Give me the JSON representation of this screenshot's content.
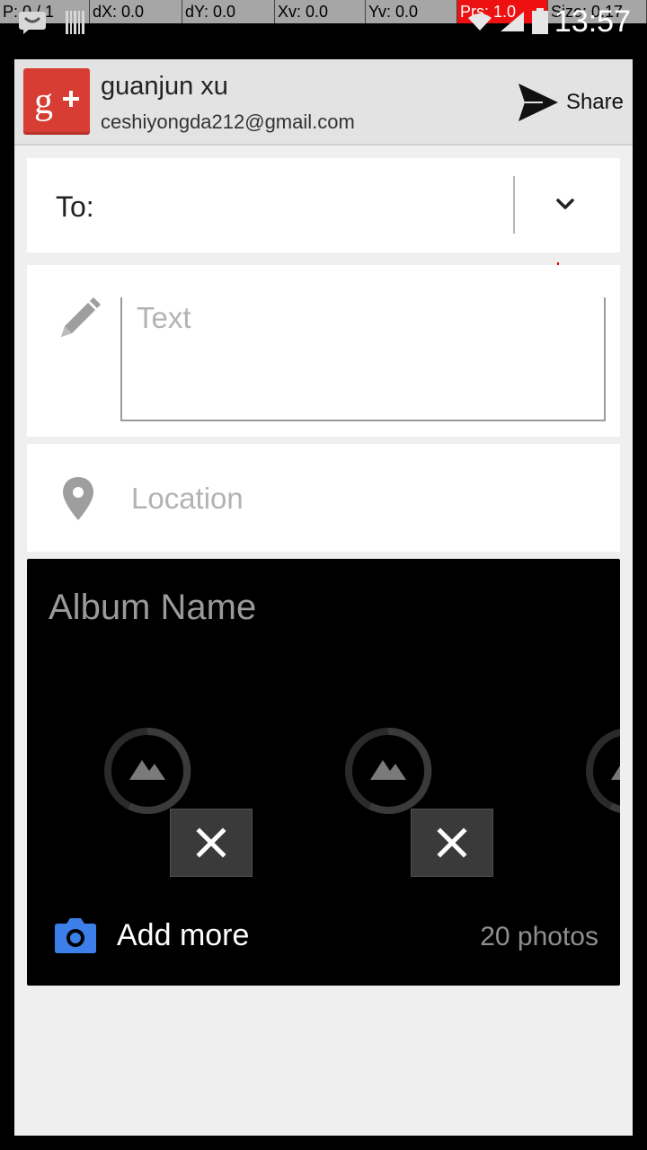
{
  "debug_overlay": {
    "pointer": "P: 0 / 1",
    "dx": "dX: 0.0",
    "dy": "dY: 0.0",
    "xv": "Xv: 0.0",
    "yv": "Yv: 0.0",
    "prs": "Prs: 1.0",
    "size": "Size: 0.17"
  },
  "status_bar": {
    "time": "13:57",
    "icons": [
      "notification-icon",
      "barcode-icon",
      "wifi-icon",
      "signal-icon",
      "battery-icon"
    ]
  },
  "header": {
    "app_icon": "google-plus-icon",
    "account_name": "guanjun xu",
    "account_email": "ceshiyongda212@gmail.com",
    "share_label": "Share"
  },
  "recipients": {
    "label": "To:"
  },
  "post": {
    "text_placeholder": "Text",
    "location_placeholder": "Location"
  },
  "album": {
    "name_placeholder": "Album Name",
    "add_more_label": "Add more",
    "photo_count": "20 photos"
  },
  "colors": {
    "gplus_red": "#d73d32",
    "camera_blue": "#3d7fe8",
    "debug_red": "#ee1111"
  }
}
